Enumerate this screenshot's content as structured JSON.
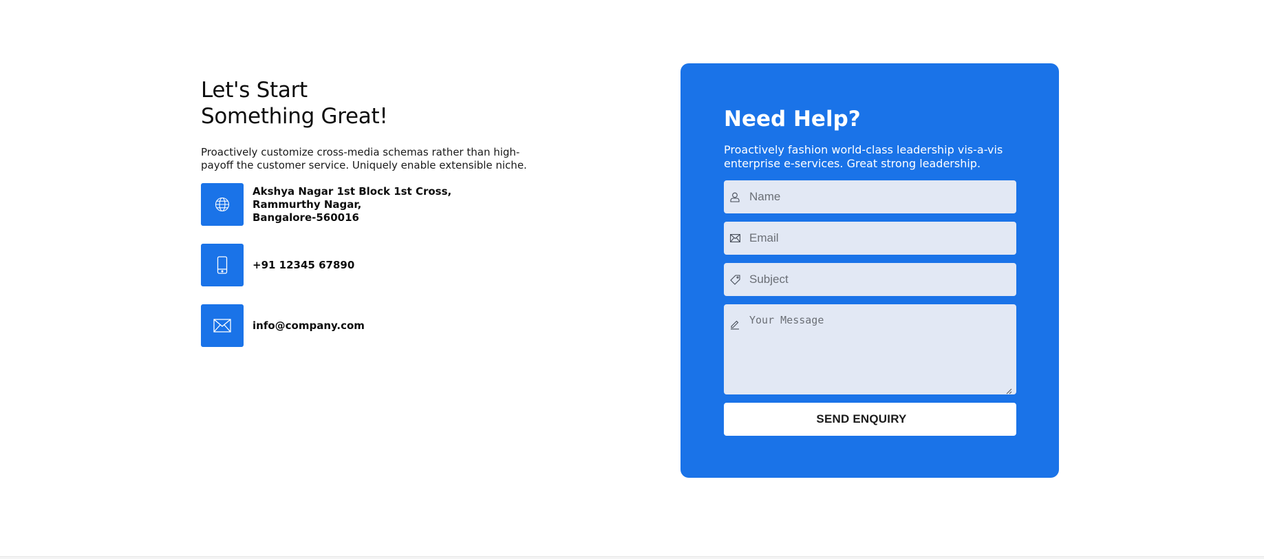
{
  "left": {
    "headline_line1": "Let's Start",
    "headline_line2": "Something Great!",
    "intro": "Proactively customize cross-media schemas rather than high-payoff the customer service. Uniquely enable extensible niche.",
    "contacts": {
      "address": {
        "icon": "globe-icon",
        "line1": "Akshya Nagar 1st Block 1st Cross,",
        "line2": "Rammurthy Nagar,",
        "line3": "Bangalore-560016"
      },
      "phone": {
        "icon": "mobile-phone-icon",
        "text": "+91 12345 67890"
      },
      "email": {
        "icon": "envelope-icon",
        "text": "info@company.com"
      }
    }
  },
  "card": {
    "title": "Need Help?",
    "description": "Proactively fashion world-class leadership vis-a-vis enterprise e-services. Great strong leadership.",
    "fields": {
      "name": {
        "icon": "user-icon",
        "placeholder": "Name",
        "value": ""
      },
      "email": {
        "icon": "envelope-icon",
        "placeholder": "Email",
        "value": ""
      },
      "subject": {
        "icon": "tag-icon",
        "placeholder": "Subject",
        "value": ""
      },
      "message": {
        "icon": "pencil-icon",
        "placeholder": "Your Message",
        "value": ""
      }
    },
    "submit_label": "SEND ENQUIRY"
  },
  "colors": {
    "accent": "#1a73e8",
    "field_bg": "#e2e8f4",
    "text_dark": "#0d0d0d",
    "white": "#ffffff"
  }
}
